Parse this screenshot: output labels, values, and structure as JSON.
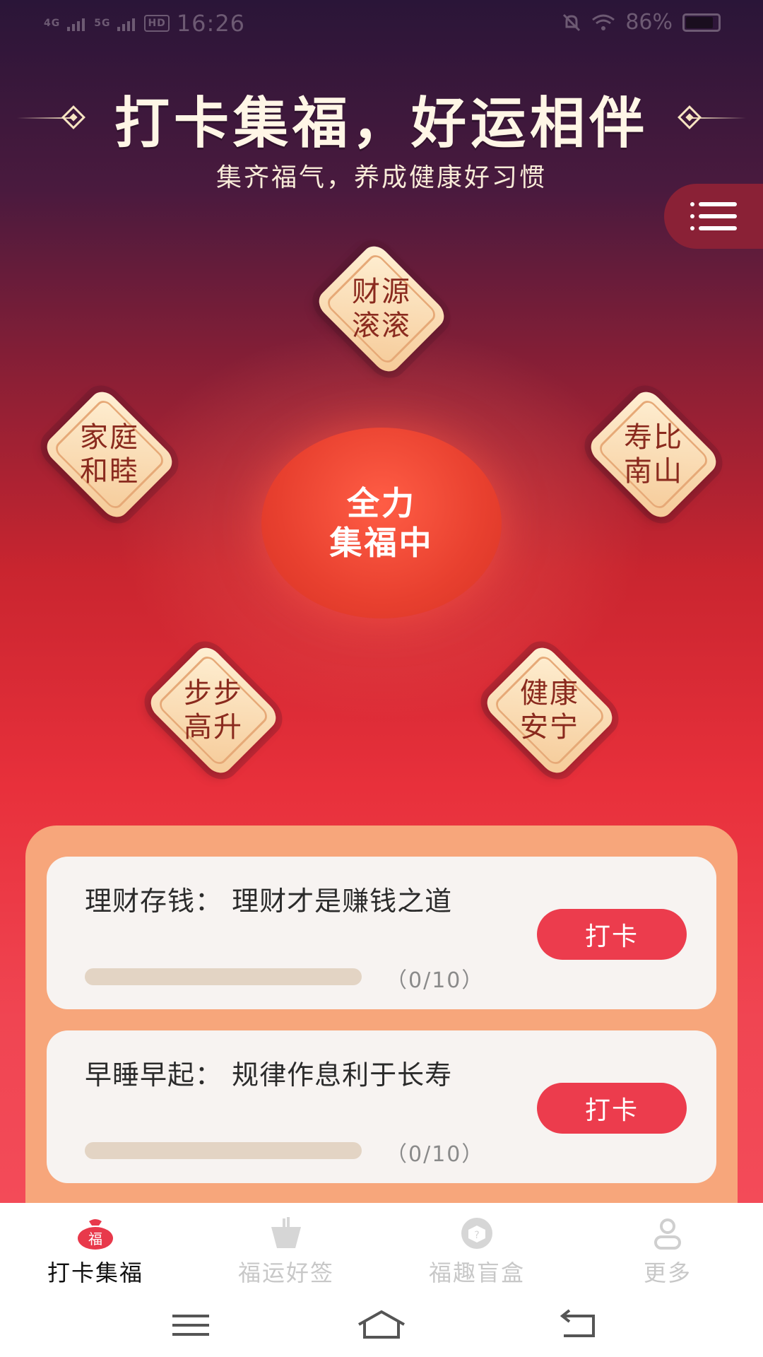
{
  "status": {
    "network1": "4G",
    "network2": "5G",
    "hd": "HD",
    "time": "16:26",
    "battery": "86%"
  },
  "header": {
    "title": "打卡集福，好运相伴",
    "subtitle": "集齐福气，养成健康好习惯"
  },
  "charms": [
    {
      "line1": "财源",
      "line2": "滚滚"
    },
    {
      "line1": "家庭",
      "line2": "和睦"
    },
    {
      "line1": "寿比",
      "line2": "南山"
    },
    {
      "line1": "步步",
      "line2": "高升"
    },
    {
      "line1": "健康",
      "line2": "安宁"
    }
  ],
  "center": {
    "line1": "全力",
    "line2": "集福中"
  },
  "tasks": [
    {
      "label": "理财存钱：  理财才是赚钱之道",
      "progress_text": "（0/10）",
      "progress": 0,
      "button": "打卡"
    },
    {
      "label": "早睡早起：  规律作息利于长寿",
      "progress_text": "（0/10）",
      "progress": 0,
      "button": "打卡"
    }
  ],
  "tabs": [
    {
      "label": "打卡集福",
      "icon": "fortune-bag-icon",
      "active": true
    },
    {
      "label": "福运好签",
      "icon": "lottery-stick-icon",
      "active": false
    },
    {
      "label": "福趣盲盒",
      "icon": "blind-box-icon",
      "active": false
    },
    {
      "label": "更多",
      "icon": "person-icon",
      "active": false
    }
  ],
  "colors": {
    "accent": "#ec3c4d",
    "panel": "#f7a67b",
    "charm_text": "#8a2a1e"
  }
}
